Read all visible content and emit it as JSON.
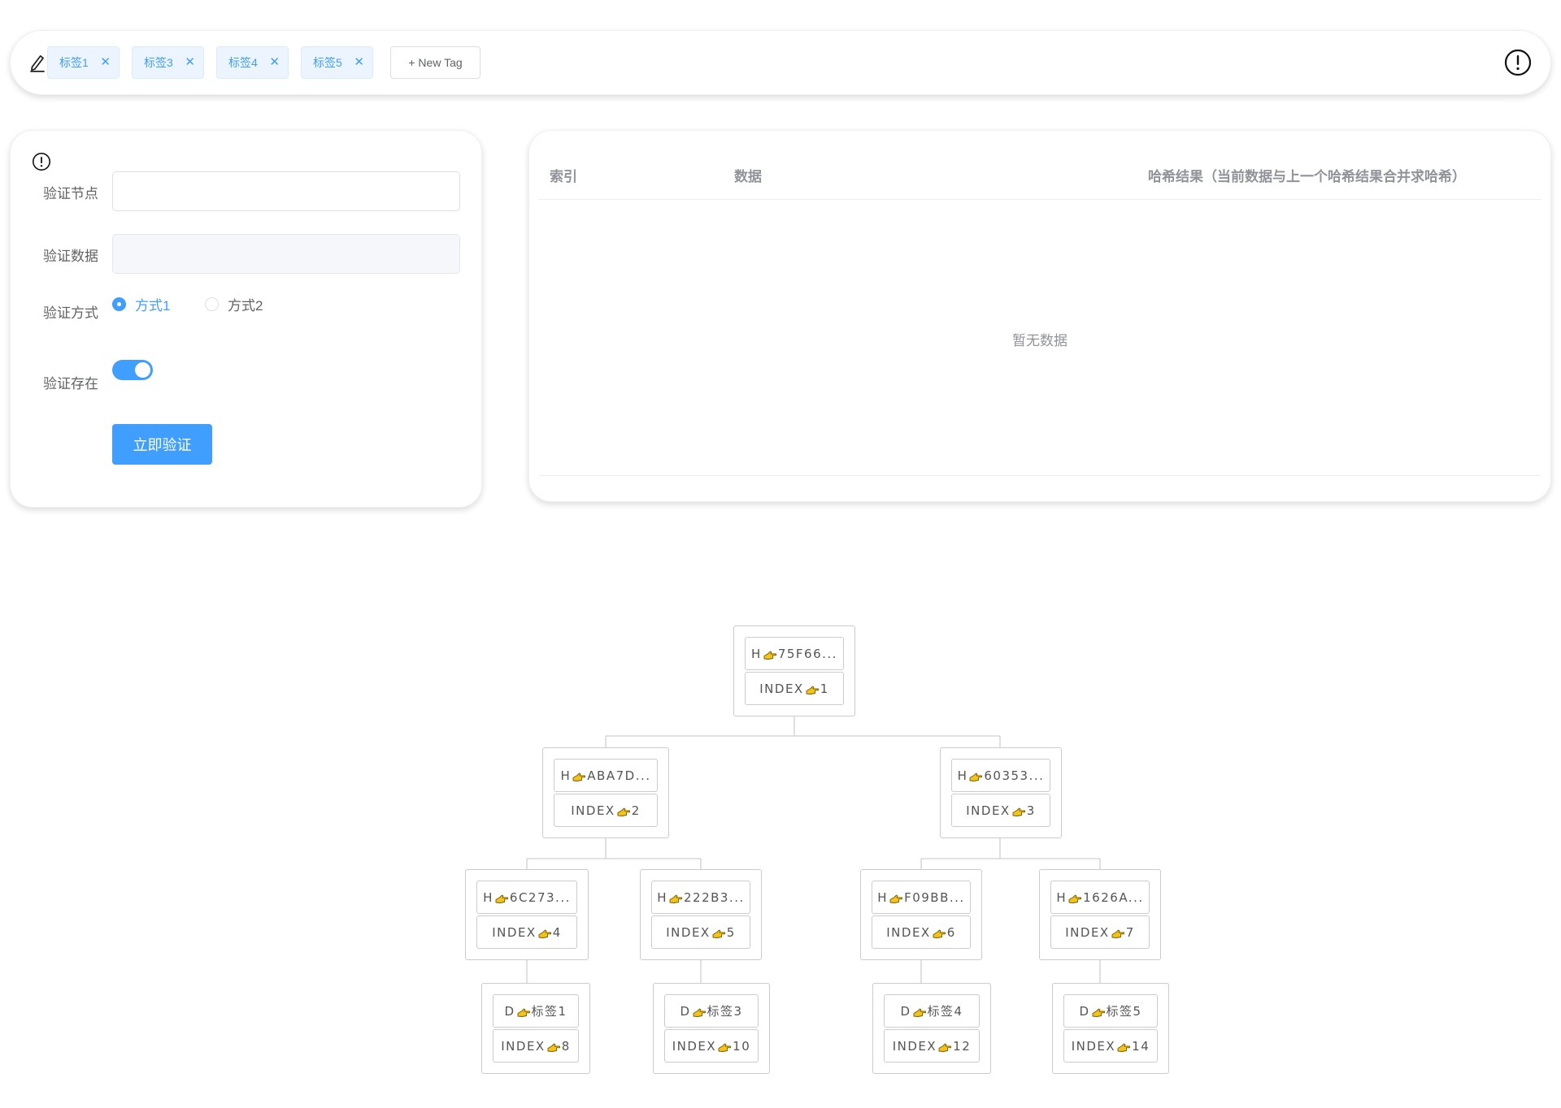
{
  "tag_bar": {
    "tags": [
      {
        "label": "标签1"
      },
      {
        "label": "标签3"
      },
      {
        "label": "标签4"
      },
      {
        "label": "标签5"
      }
    ],
    "new_tag_label": "+ New Tag"
  },
  "verify_form": {
    "node_label": "验证节点",
    "node_value": "",
    "data_label": "验证数据",
    "data_value": "",
    "method_label": "验证方式",
    "method_options": [
      "方式1",
      "方式2"
    ],
    "method_selected": "方式1",
    "exist_label": "验证存在",
    "exist_enabled": true,
    "submit_label": "立即验证"
  },
  "result_table": {
    "columns": [
      "索引",
      "数据",
      "哈希结果（当前数据与上一个哈希结果合并求哈希）"
    ],
    "rows": [],
    "empty_text": "暂无数据"
  },
  "tree": {
    "nodes": [
      {
        "top": "H",
        "top_value": "75F66...",
        "bottom": "INDEX",
        "bottom_value": "1"
      },
      {
        "top": "H",
        "top_value": "ABA7D...",
        "bottom": "INDEX",
        "bottom_value": "2"
      },
      {
        "top": "H",
        "top_value": "60353...",
        "bottom": "INDEX",
        "bottom_value": "3"
      },
      {
        "top": "H",
        "top_value": "6C273...",
        "bottom": "INDEX",
        "bottom_value": "4"
      },
      {
        "top": "H",
        "top_value": "222B3...",
        "bottom": "INDEX",
        "bottom_value": "5"
      },
      {
        "top": "H",
        "top_value": "F09BB...",
        "bottom": "INDEX",
        "bottom_value": "6"
      },
      {
        "top": "H",
        "top_value": "1626A...",
        "bottom": "INDEX",
        "bottom_value": "7"
      },
      {
        "top": "D",
        "top_value": "标签1",
        "bottom": "INDEX",
        "bottom_value": "8"
      },
      {
        "top": "D",
        "top_value": "标签3",
        "bottom": "INDEX",
        "bottom_value": "10"
      },
      {
        "top": "D",
        "top_value": "标签4",
        "bottom": "INDEX",
        "bottom_value": "12"
      },
      {
        "top": "D",
        "top_value": "标签5",
        "bottom": "INDEX",
        "bottom_value": "14"
      }
    ]
  },
  "icons": {
    "edit": "pencil-edit-icon",
    "info": "exclamation-circle-icon",
    "close": "close-icon",
    "pointer": "pointing-hand-icon"
  },
  "colors": {
    "primary": "#409eff",
    "tag_background": "#ecf5ff",
    "text": "#606266",
    "muted": "#909399",
    "pointer_fill": "#f2c318"
  }
}
